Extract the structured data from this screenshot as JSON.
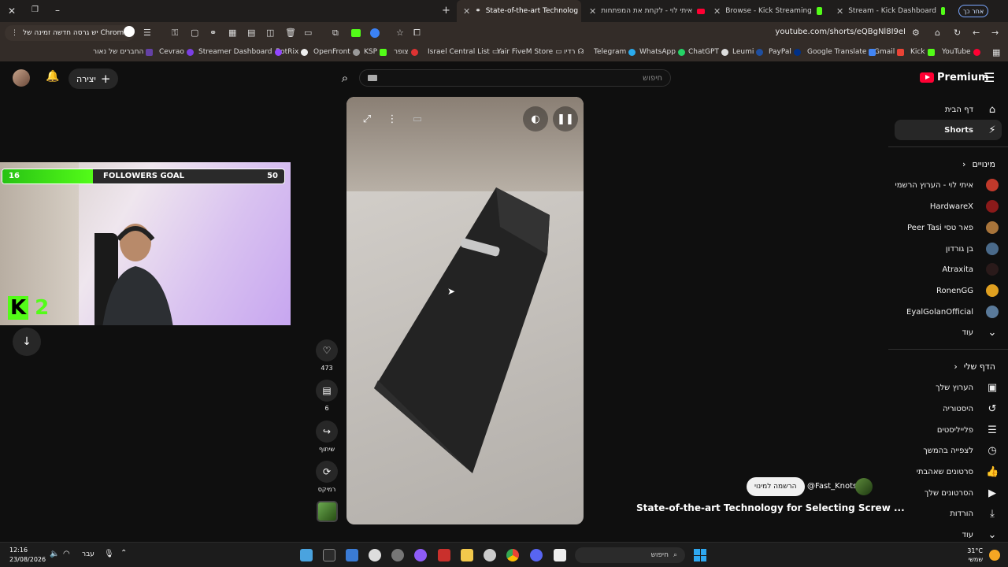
{
  "browser": {
    "tabs": [
      {
        "title": "State-of-the-art Technolog",
        "active": true
      },
      {
        "title": "איתי לוי - לקחת את המפתחות",
        "active": false
      },
      {
        "title": "Browse - Kick Streaming",
        "active": false
      },
      {
        "title": "Stream - Kick Dashboard",
        "active": false
      }
    ],
    "profile_label": "אחר כך",
    "update_notice": "יש גרסה חדשה זמינה של Chrome",
    "url": "youtube.com/shorts/eQBgNl8I9eI",
    "bookmarks": [
      "YouTube",
      "Kick",
      "Gmail",
      "Google Translate",
      "PayPal",
      "Leumi",
      "ChatGPT",
      "WhatsApp",
      "Telegram",
      "רדיו",
      "Yair FiveM Store",
      "Israel Central List",
      "צופר",
      "KSP",
      "OpenFront",
      "BotRix",
      "Streamer Dashboard",
      "Cevrao",
      "החברים של נאור"
    ]
  },
  "masthead": {
    "create_label": "יצירה",
    "search_placeholder": "חיפוש",
    "logo_text": "Premium"
  },
  "sidebar": {
    "home": "דף הבית",
    "shorts": "Shorts",
    "subscriptions_header": "מינויים",
    "subscriptions": [
      {
        "name": "איתי לוי - הערוץ הרשמי",
        "color": "#c0392b"
      },
      {
        "name": "HardwareX",
        "color": "#8b1a1a"
      },
      {
        "name": "Peer Tasi פאר טסי",
        "color": "#a8743a"
      },
      {
        "name": "בן גורדון",
        "color": "#4a6a8a"
      },
      {
        "name": "Atraxita",
        "color": "#2a1a1a"
      },
      {
        "name": "RonenGG",
        "color": "#e0a020"
      },
      {
        "name": "EyalGolanOfficial",
        "color": "#5a7a9a"
      }
    ],
    "more": "עוד",
    "you_header": "הדף שלי",
    "you_items": [
      "הערוץ שלך",
      "היסטוריה",
      "פלייליסטים",
      "לצפייה בהמשך",
      "סרטונים שאהבתי",
      "הסרטונים שלך",
      "הורדות"
    ],
    "you_more": "עוד"
  },
  "stream_overlay": {
    "followers_current": "16",
    "followers_label": "FOLLOWERS GOAL",
    "followers_goal": "50",
    "followers_progress": 0.32,
    "kick_counter": "2"
  },
  "short": {
    "likes": "473",
    "comments": "6",
    "share_label": "שיתוף",
    "remix_label": "רמיקס",
    "subscribe_label": "הרשמה למינוי",
    "channel_handle": "@Fast_Knots",
    "title": "State-of-the-art Technology for Selecting Screw ..."
  },
  "taskbar": {
    "time": "12:16",
    "date": "23/08/2026",
    "lang": "עבר",
    "search_placeholder": "חיפוש",
    "temperature": "31°C",
    "weather": "שמשי"
  },
  "colors": {
    "yt_red": "#ff0033",
    "kick_green": "#53fc18",
    "background": "#0f0f0f"
  }
}
